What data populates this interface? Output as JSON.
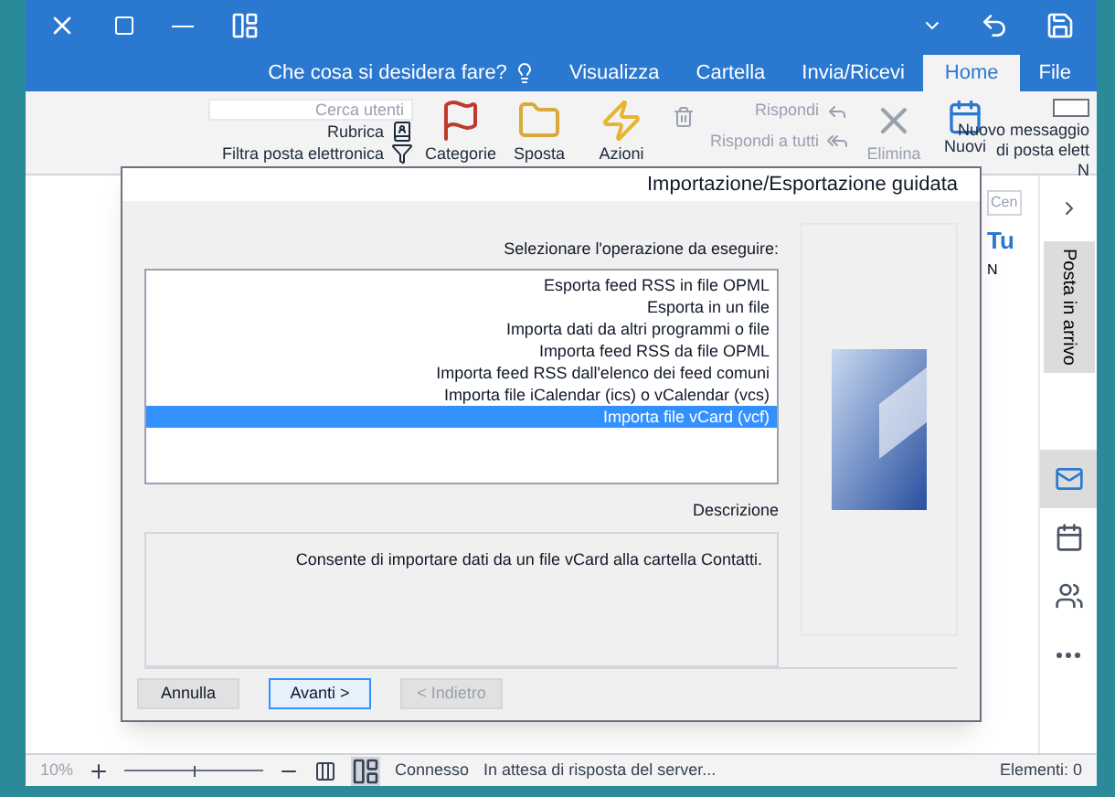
{
  "window": {
    "tell_me": "Che cosa si desidera fare?",
    "tabs": [
      {
        "label": "Visualizza",
        "selected": false
      },
      {
        "label": "Cartella",
        "selected": false
      },
      {
        "label": "Invia/Ricevi",
        "selected": false
      },
      {
        "label": "Home",
        "selected": true
      },
      {
        "label": "File",
        "selected": false
      }
    ]
  },
  "ribbon": {
    "new_message": [
      "Nuovo messaggio",
      "di posta elett",
      "N"
    ],
    "new_items": "Nuovi",
    "delete": "Elimina",
    "reply": "Rispondi",
    "reply_all": "Rispondi a tutti",
    "actions": "Azioni",
    "move": "Sposta",
    "categories": "Categorie",
    "search_people": {
      "placeholder": "Cerca utenti"
    },
    "address_book": "Rubrica",
    "filter_email": "Filtra posta elettronica"
  },
  "behind": {
    "search_fragment": "Cen",
    "folder_title": "Tu",
    "folder_sub": "N"
  },
  "nav": {
    "inbox_tab": "Posta in arrivo",
    "items": [
      {
        "kind": "mail",
        "selected": true
      },
      {
        "kind": "calendar",
        "selected": false
      },
      {
        "kind": "people",
        "selected": false
      },
      {
        "kind": "more",
        "selected": false
      }
    ]
  },
  "dialog": {
    "title": "Importazione/Esportazione guidata",
    "prompt": "Selezionare l'operazione da eseguire:",
    "options": [
      {
        "label": "Esporta feed RSS in file OPML",
        "selected": false
      },
      {
        "label": "Esporta in un file",
        "selected": false
      },
      {
        "label": "Importa dati da altri programmi o file",
        "selected": false
      },
      {
        "label": "Importa feed RSS da file OPML",
        "selected": false
      },
      {
        "label": "Importa feed RSS dall'elenco dei feed comuni",
        "selected": false
      },
      {
        "label": "Importa file iCalendar (ics) o vCalendar (vcs)",
        "selected": false
      },
      {
        "label": "Importa file vCard (vcf)",
        "selected": true
      }
    ],
    "description_label": "Descrizione",
    "description": "Consente di importare dati da un file vCard alla cartella Contatti.",
    "buttons": [
      {
        "label": "Annulla",
        "kind": "normal",
        "disabled": false
      },
      {
        "label": "Avanti >",
        "kind": "default",
        "disabled": false
      },
      {
        "label": "< Indietro",
        "kind": "normal",
        "disabled": true
      }
    ]
  },
  "status_bar": {
    "items_count": "Elementi: 0",
    "waiting": "In attesa di risposta del server...",
    "connected": "Connesso",
    "zoom": "10%",
    "zoom_slider": {
      "level": 0.5
    }
  }
}
